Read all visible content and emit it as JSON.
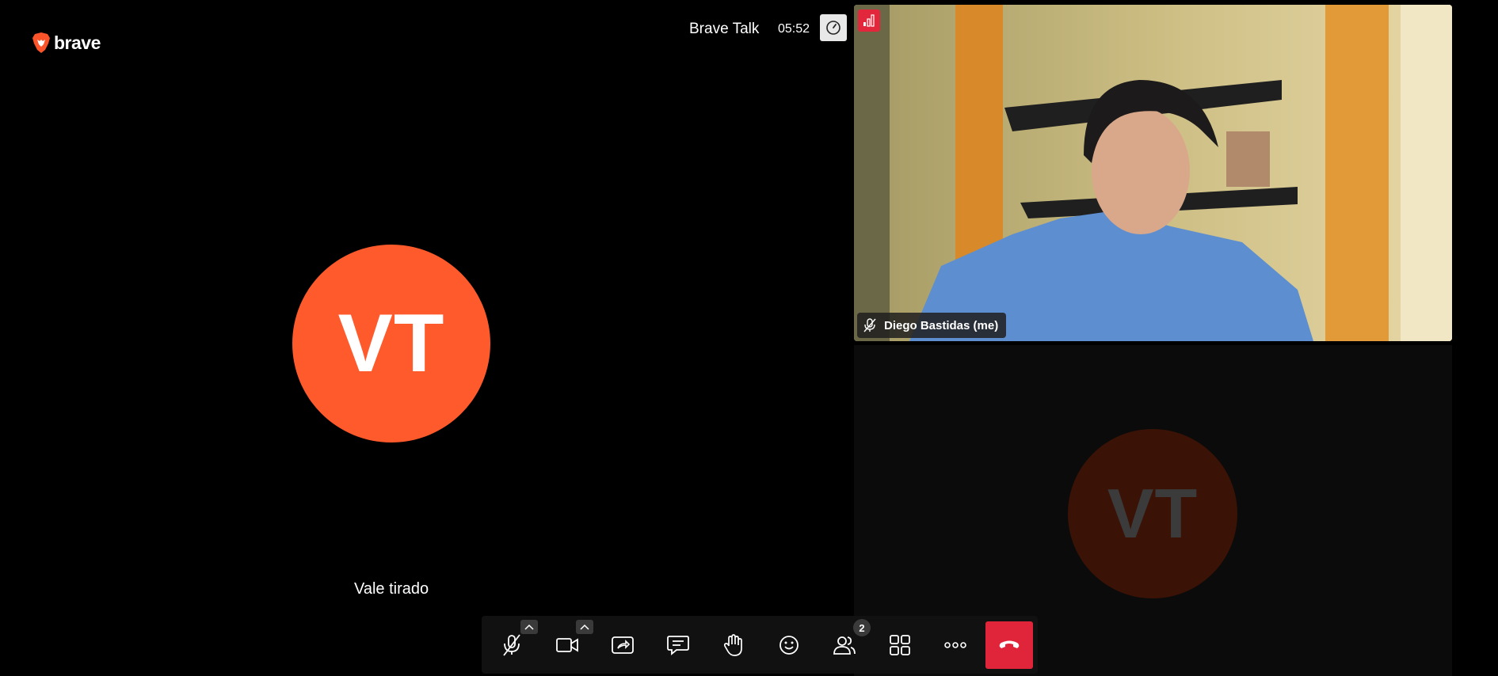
{
  "app": {
    "logo_text": "brave",
    "room_title": "Brave Talk",
    "timer": "05:52"
  },
  "main_participant": {
    "initials": "VT",
    "name": "Vale tirado",
    "avatar_color": "#ff5a2c"
  },
  "self_view": {
    "label": "Diego Bastidas (me)",
    "mic_state": "muted"
  },
  "second_tile": {
    "initials": "VT"
  },
  "toolbar": {
    "participants_count": "2",
    "buttons": [
      "mic-muted-icon",
      "camera-icon",
      "share-screen-icon",
      "chat-icon",
      "raise-hand-icon",
      "emoji-icon",
      "participants-icon",
      "tile-view-icon",
      "more-icon",
      "hangup-icon"
    ],
    "hangup_color": "#e0243a"
  }
}
